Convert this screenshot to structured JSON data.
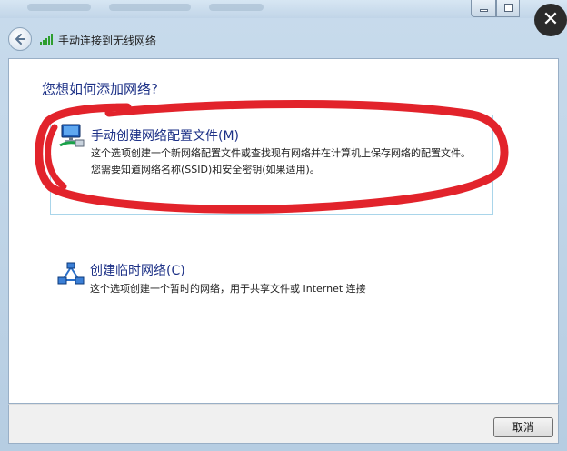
{
  "window": {
    "title": "手动连接到无线网络",
    "close_glyph": "✕",
    "caption_buttons": [
      "minimize-icon",
      "maximize-icon"
    ]
  },
  "main": {
    "question": "您想如何添加网络?",
    "options": [
      {
        "title": "手动创建网络配置文件(M)",
        "description": "这个选项创建一个新网络配置文件或查找现有网络并在计算机上保存网络的配置文件。您需要知道网络名称(SSID)和安全密钥(如果适用)。",
        "icon": "network-computer-icon",
        "highlighted": true
      },
      {
        "title": "创建临时网络(C)",
        "description": "这个选项创建一个暂时的网络，用于共享文件或 Internet 连接",
        "icon": "adhoc-network-icon",
        "highlighted": false
      }
    ]
  },
  "footer": {
    "cancel_label": "取消"
  },
  "colors": {
    "link_blue": "#1e3287",
    "annotation_red": "#e2232b",
    "highlight_border": "#a9d5ea"
  }
}
